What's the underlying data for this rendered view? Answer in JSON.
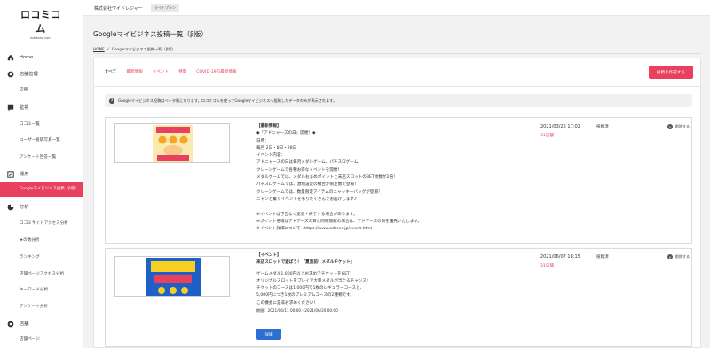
{
  "brand": {
    "logo_main": "ロコミコム",
    "logo_sub": "kotikomi.com"
  },
  "topbar": {
    "company": "株式会社ワイドレジャー",
    "plan": "ライトプラン"
  },
  "sidebar": {
    "items": [
      {
        "label": "Home",
        "type": "category",
        "icon": "home-icon"
      },
      {
        "label": "店舗管理",
        "type": "category",
        "icon": "settings-icon"
      },
      {
        "label": "店舗",
        "type": "sub"
      },
      {
        "label": "監視",
        "type": "category",
        "icon": "chat-icon"
      },
      {
        "label": "ロコミ一覧",
        "type": "sub"
      },
      {
        "label": "ユーザー投稿写真一覧",
        "type": "sub"
      },
      {
        "label": "アンケート回答一覧",
        "type": "sub"
      },
      {
        "label": "運用",
        "type": "category",
        "icon": "edit-icon"
      },
      {
        "label": "Googleマイビジネス投稿（β版）",
        "type": "sub",
        "active": true
      },
      {
        "label": "分析",
        "type": "category",
        "icon": "chart-icon"
      },
      {
        "label": "ロコミサイトアクセス分析",
        "type": "sub"
      },
      {
        "label": "★の数分析",
        "type": "sub"
      },
      {
        "label": "ランキング",
        "type": "sub"
      },
      {
        "label": "店舗ページアクセス分析",
        "type": "sub"
      },
      {
        "label": "キーワード分析",
        "type": "sub"
      },
      {
        "label": "アンケート分析",
        "type": "sub"
      },
      {
        "label": "店舗",
        "type": "category",
        "icon": "settings-icon"
      },
      {
        "label": "店舗ページ",
        "type": "sub"
      }
    ]
  },
  "page": {
    "title": "Googleマイビジネス投稿一覧（β版）",
    "breadcrumb_home": "HOME",
    "breadcrumb_sep": "/",
    "breadcrumb_current": "Googleマイビジネス投稿一覧（β版）"
  },
  "tabs": [
    {
      "label": "すべて",
      "active": true
    },
    {
      "label": "最新情報",
      "active": false
    },
    {
      "label": "イベント",
      "active": false
    },
    {
      "label": "特典",
      "active": false
    },
    {
      "label": "COVID-19の最新情報",
      "active": false
    }
  ],
  "create_button": "投稿を作成する",
  "notice": "Googleマイビジネス投稿はベータ版になります。ロコミコムを使ってGoogleマイビジネスへ投稿したデータのみが表示されます。",
  "posts": [
    {
      "type_label": "【最新情報】",
      "lines": [
        "◆『アドニャーズの日』開催！◆",
        "日時：",
        "毎月 2日・8日・28日",
        "イベント内容：",
        "アドニャーズの日は毎月メダルゲーム、パチスロゲーム、",
        "クレーンゲームで各種お得なイベントを開催！",
        "メダルゲームでは、メダルおまめポイントと末店スロットのBET枚数が2倍！",
        "パチスロゲームでは、激熱設定の機台が限定数で登場！",
        "クレーンゲームでは、数量限定アイテムのニャッキーバッグが登場！",
        "ニャンと驚くイベントをもりだくさんでお届けします♪",
        "",
        "※イベントは予告なく変更・終了する場合があります。",
        "※ポイント倍増はアドアーズの日と同時開催の場合は、アドアーズの日を優先いたします。",
        "※イベント詳細について→https://www.adores.jp/event.html"
      ],
      "date": "2021/03/25 17:02",
      "status": "投稿済",
      "count": "31店舗",
      "delete_label": "削除する",
      "thumb_text": "毎月開催 2 8 28 アドニャーズの日"
    },
    {
      "type_label": "【イベント】",
      "title": "来店スロットで遊ぼう！『夏直前！メダルチケット』",
      "lines": [
        "ゲームメダル1,000円以上お求めでチケットをGET！",
        "オリジナルスロットをプレイで大量メダルが当たるチャンス！",
        "チケットのコースは1,000円で1枚のレギュラーコースと、",
        "5,000円につき1枚のプレミアムコースの2種類です。",
        "この機会に是非お求めください！"
      ],
      "period": "期間：2021/06/11 00:00 - 2021/06/20 00:00",
      "detail_button": "詳細",
      "date": "2021/06/07 18:15",
      "status": "投稿済",
      "count": "31店舗",
      "delete_label": "削除する",
      "thumb_text": "夏直前 メダルチケット"
    }
  ],
  "colors": {
    "accent": "#e8405e",
    "button_blue": "#2f6fd3"
  }
}
